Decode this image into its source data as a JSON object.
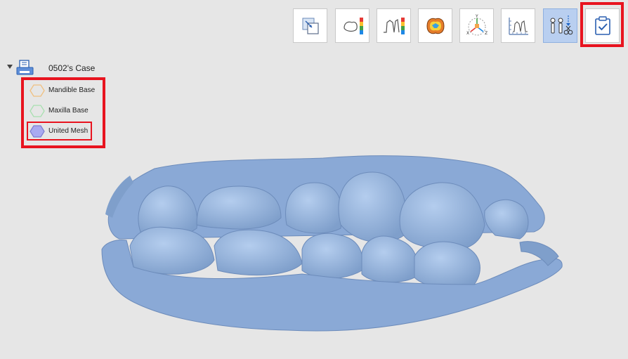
{
  "toolbar": {
    "buttons": [
      {
        "name": "move-tool",
        "icon": "move-icon"
      },
      {
        "name": "distance-map",
        "icon": "tooth-color-scale-icon"
      },
      {
        "name": "cross-section-map",
        "icon": "profile-color-scale-icon"
      },
      {
        "name": "occlusion-map",
        "icon": "occlusion-heatmap-icon"
      },
      {
        "name": "coordinate-axis",
        "icon": "xyz-axis-icon"
      },
      {
        "name": "measure",
        "icon": "ruler-profile-icon"
      },
      {
        "name": "trim-tool",
        "icon": "trim-scissors-icon",
        "active": true
      },
      {
        "name": "confirm",
        "icon": "clipboard-check-icon"
      }
    ]
  },
  "tree": {
    "case_label": "0502's Case",
    "items": [
      {
        "label": "Mandible Base",
        "color": "#f0c080"
      },
      {
        "label": "Maxilla Base",
        "color": "#a8e0b0"
      },
      {
        "label": "United Mesh",
        "color": "#a9a9f0"
      }
    ]
  },
  "colors": {
    "highlight": "#e8141f",
    "model": "#8fb0dc",
    "active_button": "#b9cff0"
  }
}
